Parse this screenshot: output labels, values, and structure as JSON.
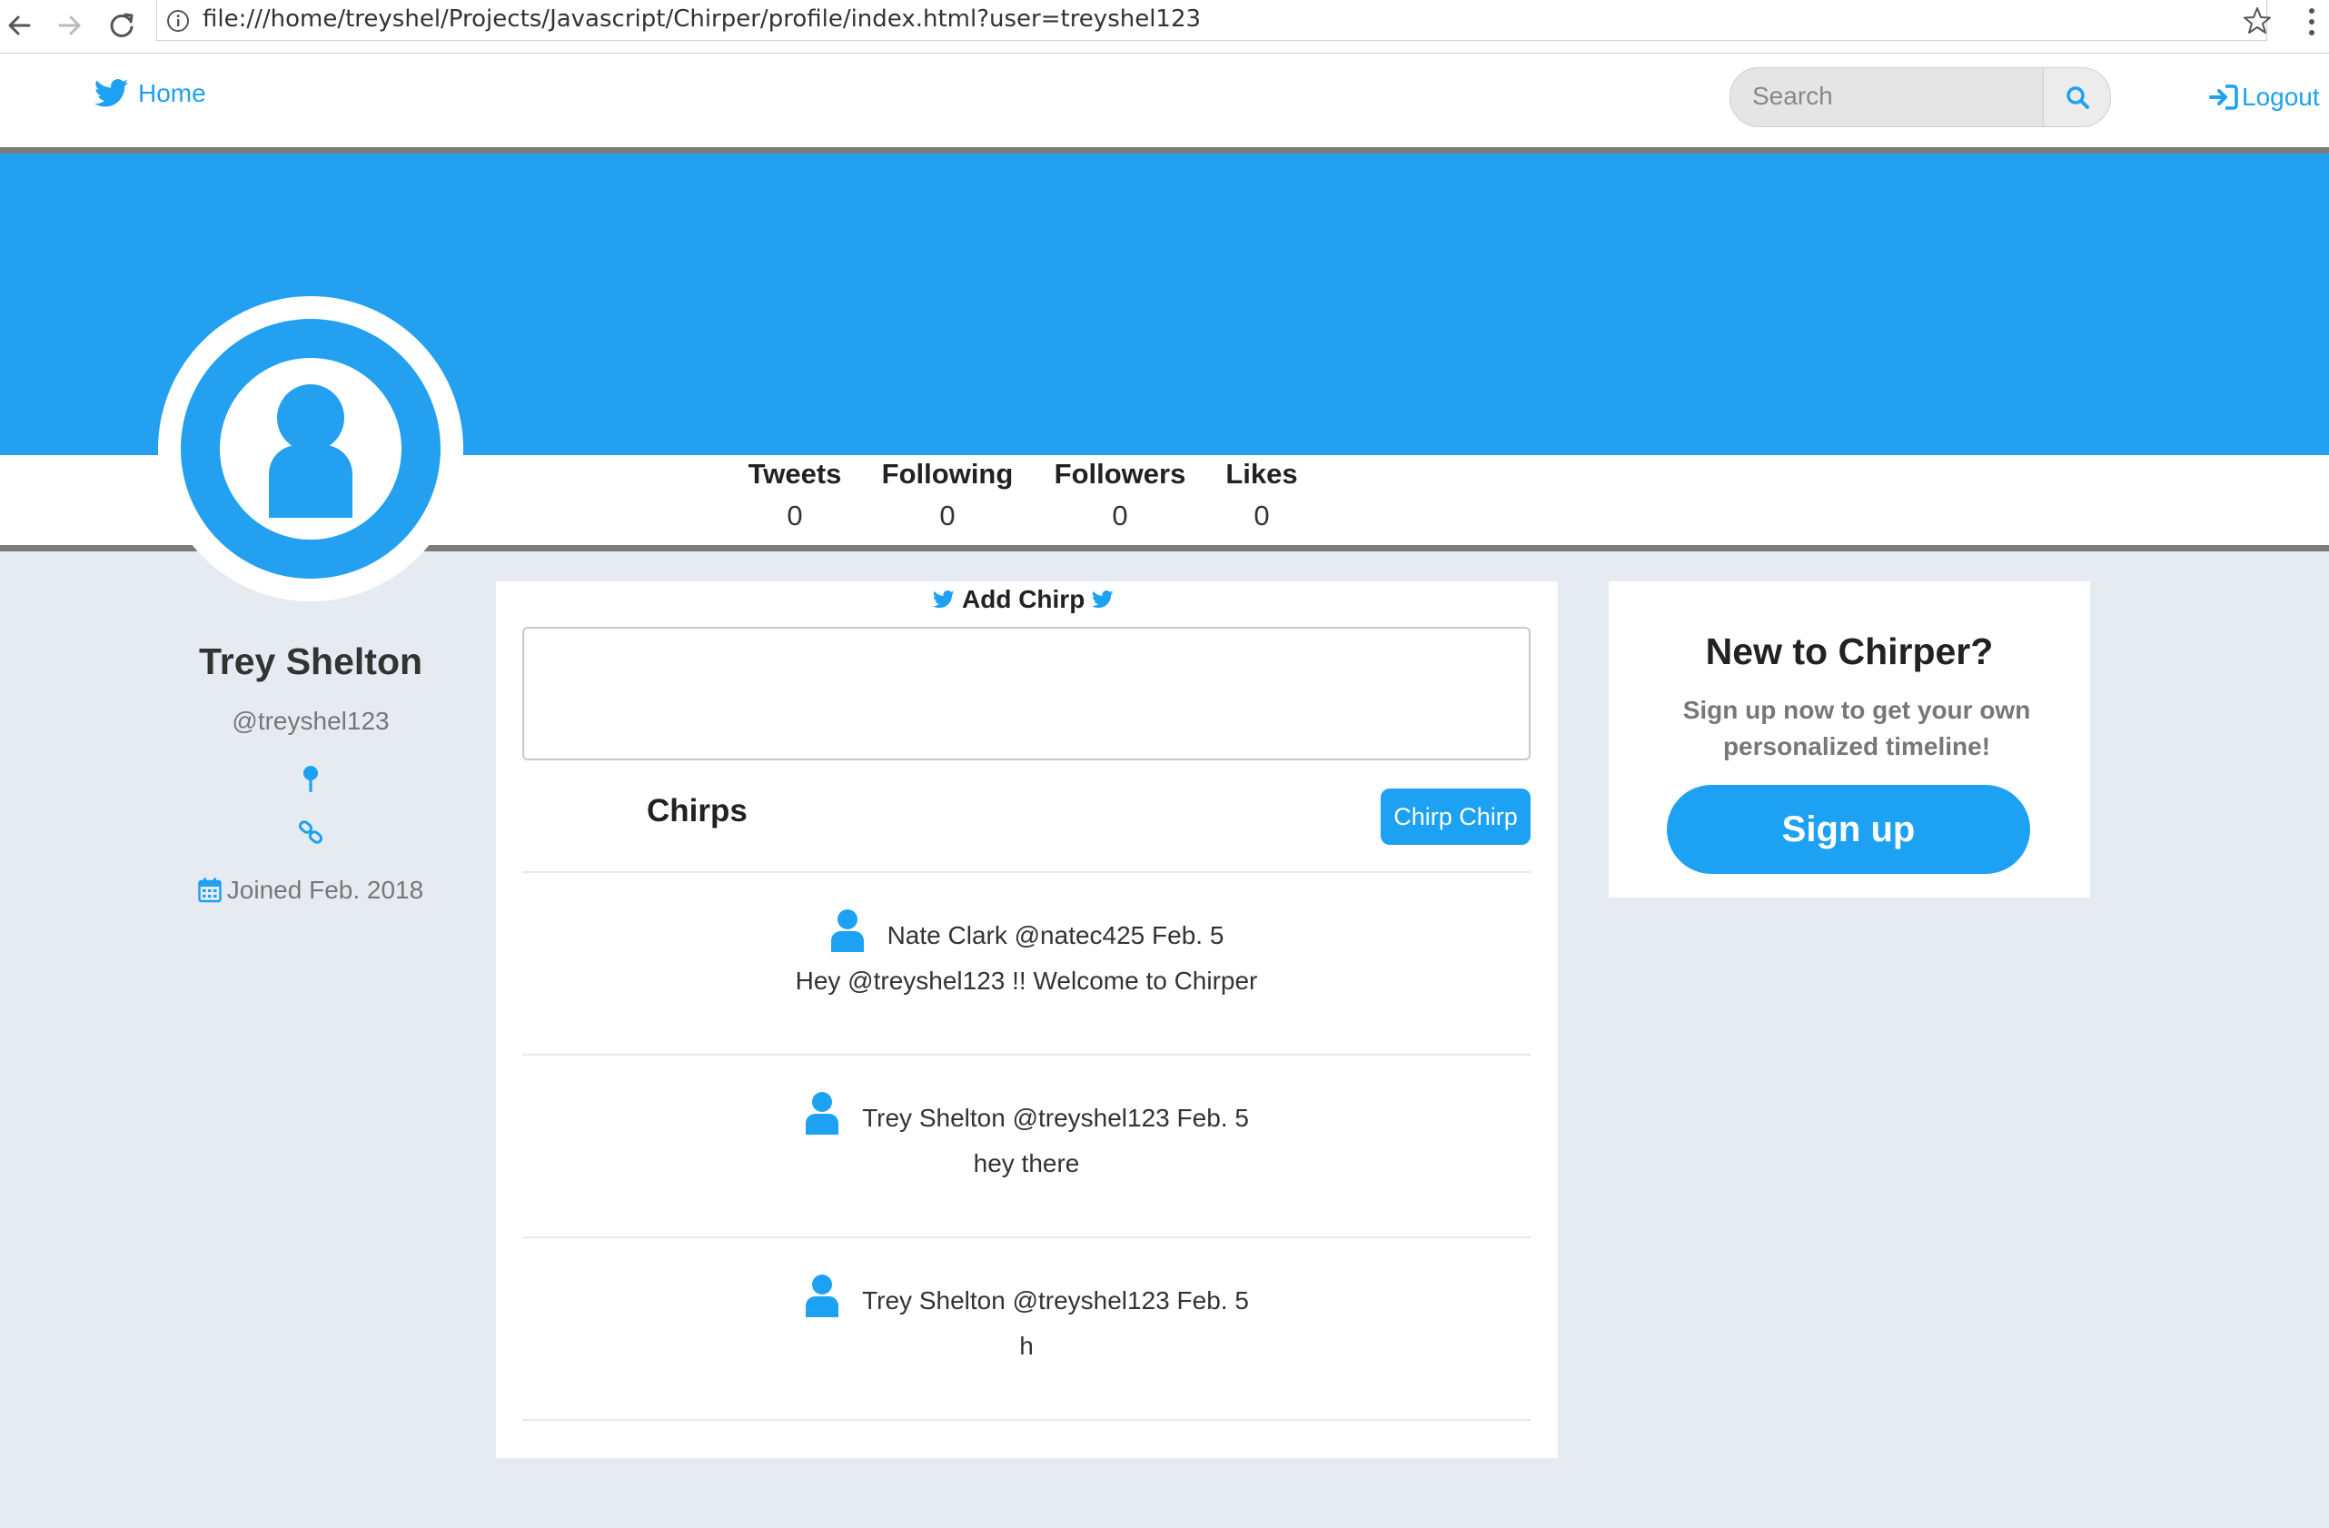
{
  "browser": {
    "url": "file:///home/treyshel/Projects/Javascript/Chirper/profile/index.html?user=treyshel123"
  },
  "navbar": {
    "home_label": "Home",
    "search_placeholder": "Search",
    "logout_label": "Logout"
  },
  "stats": [
    {
      "label": "Tweets",
      "value": "0"
    },
    {
      "label": "Following",
      "value": "0"
    },
    {
      "label": "Followers",
      "value": "0"
    },
    {
      "label": "Likes",
      "value": "0"
    }
  ],
  "profile": {
    "name": "Trey Shelton",
    "handle": "@treyshel123",
    "joined": "Joined Feb. 2018"
  },
  "feed": {
    "add_chirp_label": "Add Chirp",
    "chirps_title": "Chirps",
    "chirp_button": "Chirp Chirp",
    "chirps": [
      {
        "meta": "Nate Clark @natec425 Feb. 5",
        "text": "Hey @treyshel123 !! Welcome to Chirper"
      },
      {
        "meta": "Trey Shelton @treyshel123 Feb. 5",
        "text": "hey there"
      },
      {
        "meta": "Trey Shelton @treyshel123 Feb. 5",
        "text": "h"
      }
    ]
  },
  "signup": {
    "title": "New to Chirper?",
    "subtitle": "Sign up now to get your own personalized timeline!",
    "button": "Sign up"
  },
  "colors": {
    "brand": "#1da1f2",
    "banner": "#23a0f0",
    "page_background": "#e6ebf2"
  }
}
